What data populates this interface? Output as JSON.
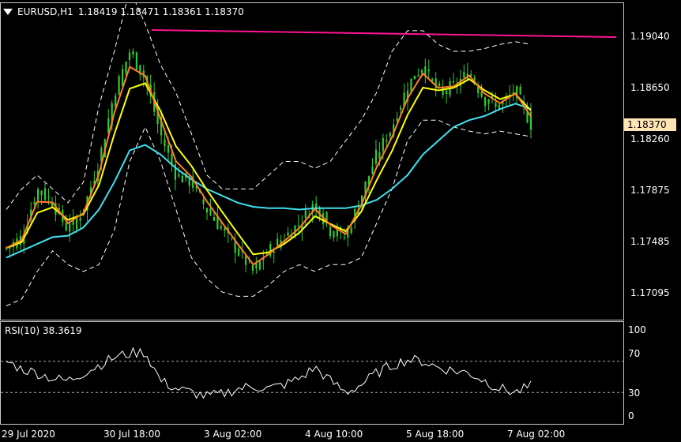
{
  "header": {
    "symbol": "EURUSD,H1",
    "ohlc": "1.18419 1.18471 1.18361 1.18370",
    "menu_icon": "triangle-down-icon"
  },
  "price_axis": {
    "ticks": [
      "1.19040",
      "1.18650",
      "1.18260",
      "1.17875",
      "1.17485",
      "1.17095"
    ],
    "current_price": "1.18370"
  },
  "rsi_panel": {
    "title": "RSI(10) 38.3619",
    "ticks": [
      "100",
      "70",
      "30",
      "0"
    ]
  },
  "time_axis": {
    "ticks": [
      "29 Jul 2020",
      "30 Jul 18:00",
      "3 Aug 02:00",
      "4 Aug 10:00",
      "5 Aug 18:00",
      "7 Aug 02:00"
    ]
  },
  "colors": {
    "background": "#000000",
    "bars": "#32cd32",
    "ema_fast": "#ff7f27",
    "ema_mid": "#ffff00",
    "ma_slow": "#40e0f0",
    "bands": "#ffffff",
    "trendline": "#ff1493",
    "rsi_line": "#ffffff",
    "price_tag_bg": "#ffe4b5"
  },
  "chart_data": [
    {
      "type": "candlestick",
      "title": "EURUSD,H1",
      "ylim": [
        1.1695,
        1.1925
      ],
      "x": [
        "29 Jul 2020",
        "30 Jul 18:00",
        "3 Aug 02:00",
        "4 Aug 10:00",
        "5 Aug 18:00",
        "7 Aug 02:00"
      ],
      "series": [
        {
          "name": "close",
          "values": [
            1.1747,
            1.1755,
            1.179,
            1.178,
            1.176,
            1.1775,
            1.181,
            1.186,
            1.189,
            1.187,
            1.183,
            1.18,
            1.1795,
            1.1775,
            1.176,
            1.1745,
            1.173,
            1.1745,
            1.1755,
            1.1765,
            1.178,
            1.176,
            1.1755,
            1.1785,
            1.1815,
            1.1835,
            1.1865,
            1.188,
            1.186,
            1.1865,
            1.1875,
            1.1855,
            1.185,
            1.1862,
            1.1837
          ]
        },
        {
          "name": "ma_slow",
          "values": [
            1.174,
            1.1745,
            1.175,
            1.1755,
            1.1756,
            1.1762,
            1.1775,
            1.1795,
            1.1818,
            1.1822,
            1.1815,
            1.1805,
            1.1797,
            1.179,
            1.1785,
            1.178,
            1.1777,
            1.1776,
            1.1776,
            1.1775,
            1.1776,
            1.1776,
            1.1776,
            1.1778,
            1.1782,
            1.179,
            1.18,
            1.1815,
            1.1825,
            1.1835,
            1.184,
            1.1843,
            1.1848,
            1.1852,
            1.1848
          ]
        },
        {
          "name": "band_upper",
          "values": [
            1.1775,
            1.179,
            1.18,
            1.179,
            1.178,
            1.1795,
            1.185,
            1.189,
            1.1935,
            1.191,
            1.188,
            1.186,
            1.183,
            1.18,
            1.179,
            1.179,
            1.179,
            1.18,
            1.181,
            1.181,
            1.1805,
            1.181,
            1.1825,
            1.184,
            1.186,
            1.189,
            1.1905,
            1.1905,
            1.1895,
            1.189,
            1.189,
            1.1892,
            1.1895,
            1.1897,
            1.1895
          ]
        },
        {
          "name": "band_lower",
          "values": [
            1.1705,
            1.171,
            1.173,
            1.1745,
            1.1735,
            1.173,
            1.1735,
            1.176,
            1.181,
            1.1835,
            1.181,
            1.1775,
            1.174,
            1.1725,
            1.1715,
            1.1712,
            1.1712,
            1.172,
            1.173,
            1.1735,
            1.173,
            1.1735,
            1.1735,
            1.174,
            1.1765,
            1.179,
            1.1825,
            1.184,
            1.184,
            1.1835,
            1.1832,
            1.183,
            1.1832,
            1.183,
            1.1828
          ]
        }
      ]
    },
    {
      "type": "line",
      "title": "RSI(10) 38.3619",
      "ylim": [
        0,
        100
      ],
      "levels": [
        70,
        30
      ],
      "series": [
        {
          "name": "RSI(10)",
          "values": [
            70,
            60,
            55,
            48,
            45,
            55,
            65,
            75,
            80,
            82,
            45,
            35,
            30,
            25,
            28,
            35,
            38,
            35,
            40,
            48,
            62,
            45,
            30,
            40,
            55,
            65,
            72,
            70,
            62,
            58,
            55,
            45,
            35,
            30,
            38
          ]
        }
      ]
    }
  ]
}
